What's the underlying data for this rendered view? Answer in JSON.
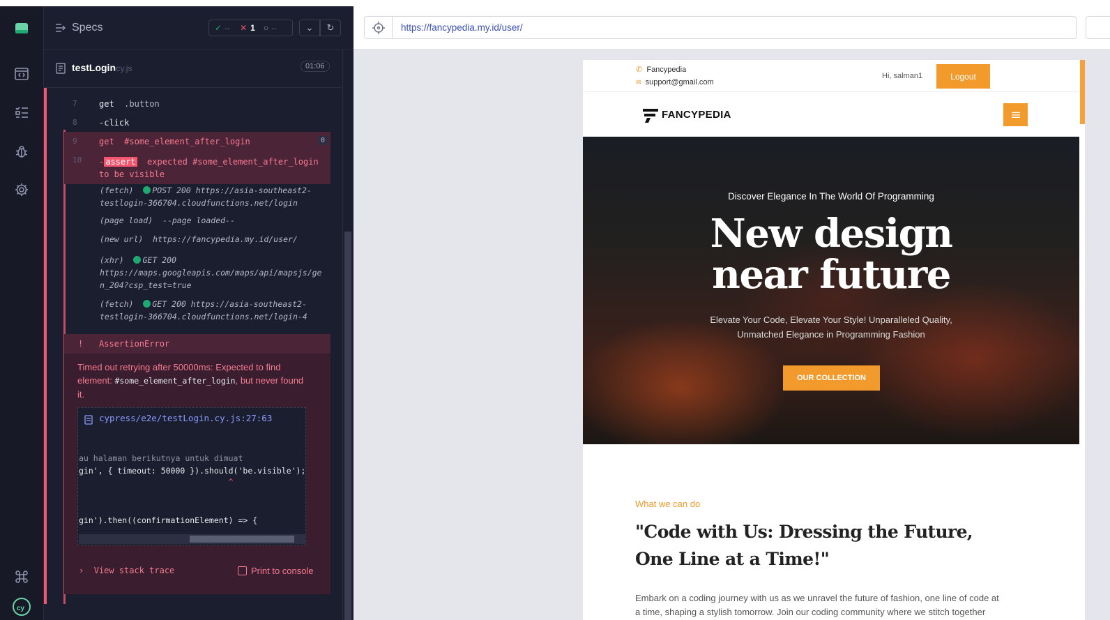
{
  "runner": {
    "nav_icons": [
      "app-logo-icon",
      "specs-icon",
      "runs-icon",
      "debug-icon",
      "settings-icon",
      "keyboard-shortcuts-icon",
      "cypress-logo-icon"
    ],
    "specs_label": "Specs",
    "stats": {
      "passed": "--",
      "failed": "1",
      "pending": "--"
    },
    "test": {
      "name": "testLogin",
      "ext": ".cy.js",
      "duration": "01:06"
    },
    "commands": [
      {
        "num": "7",
        "name": "get",
        "arg": ".button"
      },
      {
        "num": "8",
        "name": "-click",
        "arg": ""
      },
      {
        "num": "9",
        "name": "get",
        "arg": "#some_element_after_login",
        "badge": "0"
      },
      {
        "num": "10",
        "name": "-",
        "tag": "assert",
        "line1": "expected #some_element_after_login",
        "line2": "to be visible"
      }
    ],
    "events": [
      {
        "type": "(fetch)",
        "status": "POST 200",
        "url1": "https://asia-southeast2-",
        "url2": "testlogin-366704.cloudfunctions.net/login"
      },
      {
        "type": "(page load)",
        "text": "--page loaded--"
      },
      {
        "type": "(new url)",
        "text": "https://fancypedia.my.id/user/"
      },
      {
        "type": "(xhr)",
        "status": "GET 200",
        "url1": "https://maps.googleapis.com/maps/api/mapsjs/ge",
        "url2": "n_204?csp_test=true"
      },
      {
        "type": "(fetch)",
        "status": "GET 200",
        "url1": "https://asia-southeast2-",
        "url2": "testlogin-366704.cloudfunctions.net/login-4"
      }
    ],
    "error": {
      "bang": "!",
      "name": "AssertionError",
      "msg_pre": "Timed out retrying after 50000ms: Expected to find element:",
      "msg_code": "#some_element_after_login",
      "msg_post": ", but never found it.",
      "file": "cypress/e2e/testLogin.cy.js:27:63",
      "code_lines": [
        "au halaman berikutnya untuk dimuat",
        "gin', { timeout: 50000 }).should('be.visible');",
        "                               ^",
        "gin').then((confirmationElement) => {"
      ],
      "view_stack": "View stack trace",
      "print_console": "Print to console"
    }
  },
  "browser": {
    "url": "https://fancypedia.my.id/user/"
  },
  "site": {
    "contact_name": "Fancypedia",
    "contact_email": "support@gmail.com",
    "greeting": "Hi, salman1",
    "logout": "Logout",
    "logo": "FANCYPEDIA",
    "hero_sub": "Discover Elegance In The World Of Programming",
    "hero_line1": "New design",
    "hero_line2": "near future",
    "hero_p1": "Elevate Your Code, Elevate Your Style! Unparalleled Quality,",
    "hero_p2": "Unmatched Elegance in Programming Fashion",
    "hero_btn": "OUR COLLECTION",
    "what": "What we can do",
    "quote1": "\"Code with Us: Dressing the Future,",
    "quote2": "One Line at a Time!\"",
    "embark1": "Embark on a coding journey with us as we unravel the future of fashion, one line of code at",
    "embark2": "a time, shaping a stylish tomorrow. Join our coding community where we stitch together"
  },
  "colors": {
    "accent": "#f39a2d",
    "error": "#f77b90",
    "pass": "#1fa971",
    "link": "#3a4fb8"
  }
}
